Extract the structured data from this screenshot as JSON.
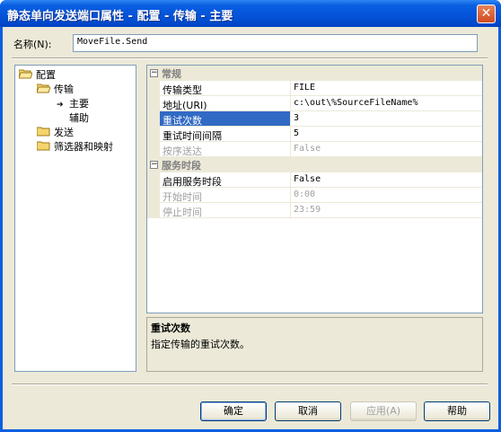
{
  "window": {
    "title": "静态单向发送端口属性 - 配置 - 传输 - 主要",
    "close_glyph": "✕"
  },
  "name_field": {
    "label": "名称(N):",
    "value": "MoveFile.Send"
  },
  "tree": {
    "items": [
      {
        "label": "配置"
      },
      {
        "label": "传输"
      },
      {
        "label": "主要",
        "marker": "➔"
      },
      {
        "label": "辅助"
      },
      {
        "label": "发送"
      },
      {
        "label": "筛选器和映射"
      }
    ]
  },
  "grid": {
    "categories": [
      {
        "label": "常规",
        "toggle": "−"
      },
      {
        "label": "服务时段",
        "toggle": "−"
      }
    ],
    "rows": [
      {
        "name": "传输类型",
        "value": "FILE"
      },
      {
        "name": "地址(URI)",
        "value": "c:\\out\\%SourceFileName%"
      },
      {
        "name": "重试次数",
        "value": "3"
      },
      {
        "name": "重试时间间隔",
        "value": "5"
      },
      {
        "name": "按序送达",
        "value": "False"
      },
      {
        "name": "启用服务时段",
        "value": "False"
      },
      {
        "name": "开始时间",
        "value": "0:00"
      },
      {
        "name": "停止时间",
        "value": "23:59"
      }
    ]
  },
  "description": {
    "title": "重试次数",
    "text": "指定传输的重试次数。"
  },
  "buttons": {
    "ok": "确定",
    "cancel": "取消",
    "apply": "应用(A)",
    "help": "帮助"
  }
}
